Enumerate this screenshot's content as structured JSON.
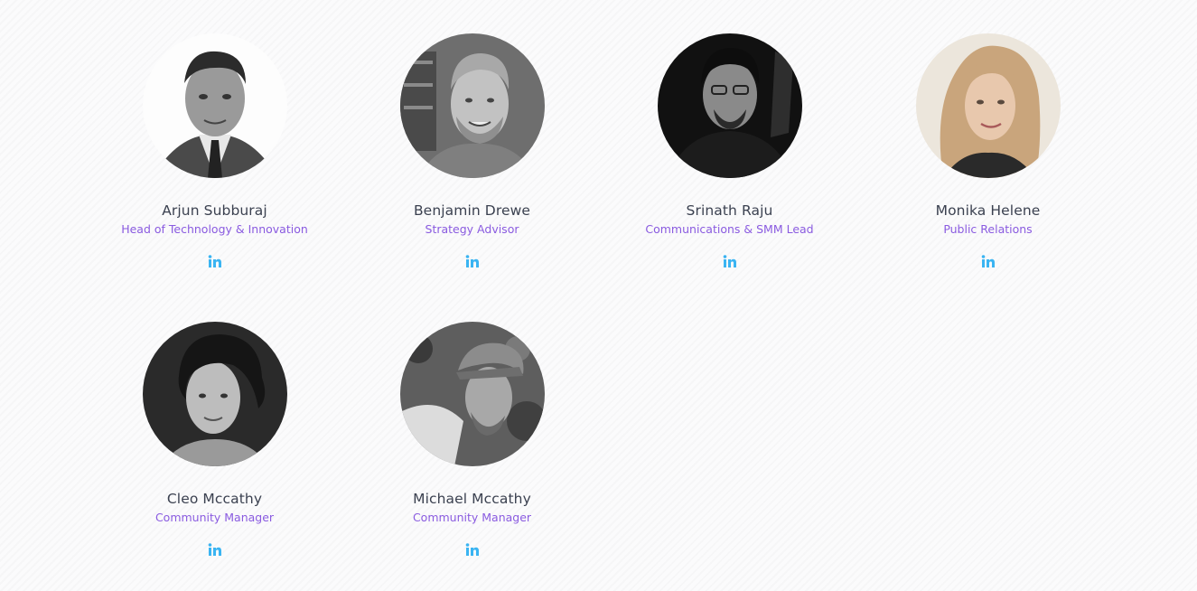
{
  "team": {
    "members": [
      {
        "name": "Arjun Subburaj",
        "role": "Head of Technology & Innovation",
        "social": "linkedin-icon"
      },
      {
        "name": "Benjamin Drewe",
        "role": "Strategy Advisor",
        "social": "linkedin-icon"
      },
      {
        "name": "Srinath Raju",
        "role": "Communications & SMM Lead",
        "social": "linkedin-icon"
      },
      {
        "name": "Monika Helene",
        "role": "Public Relations",
        "social": "linkedin-icon"
      },
      {
        "name": "Cleo Mccathy",
        "role": "Community Manager",
        "social": "linkedin-icon"
      },
      {
        "name": "Michael Mccathy",
        "role": "Community Manager",
        "social": "linkedin-icon"
      }
    ]
  },
  "colors": {
    "name_text": "#3b4150",
    "role_text": "#8a5be0",
    "linkedin_icon": "#3ab4f2",
    "background": "#fbfbfc"
  }
}
